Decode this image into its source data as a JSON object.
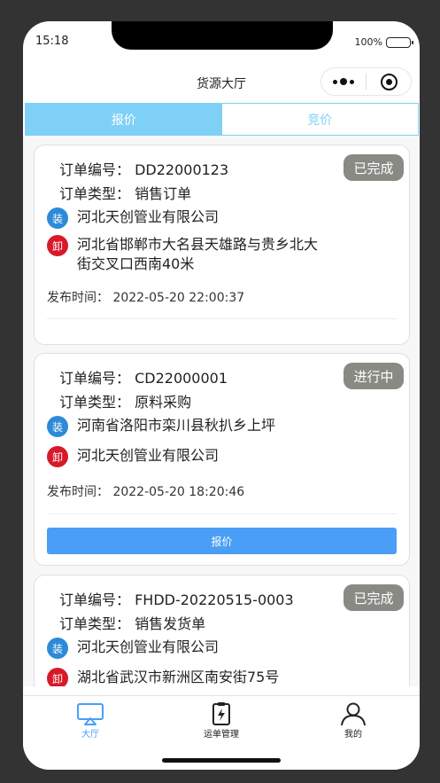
{
  "status_bar": {
    "time": "15:18",
    "battery": "100%"
  },
  "nav": {
    "title": "货源大厅"
  },
  "tabs": [
    {
      "label": "报价",
      "active": true
    },
    {
      "label": "竞价",
      "active": false
    }
  ],
  "orders": [
    {
      "order_no": "订单编号：  DD22000123",
      "order_type": "订单类型：  销售订单",
      "status": "已完成",
      "load_icon": "装",
      "load_addr": "河北天创管业有限公司",
      "unload_icon": "卸",
      "unload_addr": "河北省邯郸市大名县天雄路与贵乡北大街交叉口西南40米",
      "publish_time": "发布时间：  2022-05-20 22:00:37"
    },
    {
      "order_no": "订单编号：  CD22000001",
      "order_type": "订单类型：  原料采购",
      "status": "进行中",
      "load_icon": "装",
      "load_addr": "河南省洛阳市栾川县秋扒乡上坪",
      "unload_icon": "卸",
      "unload_addr": "河北天创管业有限公司",
      "publish_time": "发布时间：  2022-05-20 18:20:46",
      "button": "报价"
    },
    {
      "order_no": "订单编号：  FHDD-20220515-0003",
      "order_type": "订单类型：  销售发货单",
      "status": "已完成",
      "load_icon": "装",
      "load_addr": "河北天创管业有限公司",
      "unload_icon": "卸",
      "unload_addr": "湖北省武汉市新洲区南安街75号"
    }
  ],
  "tabbar": [
    {
      "label": "大厅",
      "icon": "hall-icon",
      "active": true
    },
    {
      "label": "运单管理",
      "icon": "waybill-icon",
      "active": false
    },
    {
      "label": "我的",
      "icon": "user-icon",
      "active": false
    }
  ],
  "colors": {
    "accent": "#7fd0f6",
    "button": "#4a9ef5",
    "badge": "#8a8a85",
    "load": "#2d8ad8",
    "unload": "#d8192a"
  }
}
